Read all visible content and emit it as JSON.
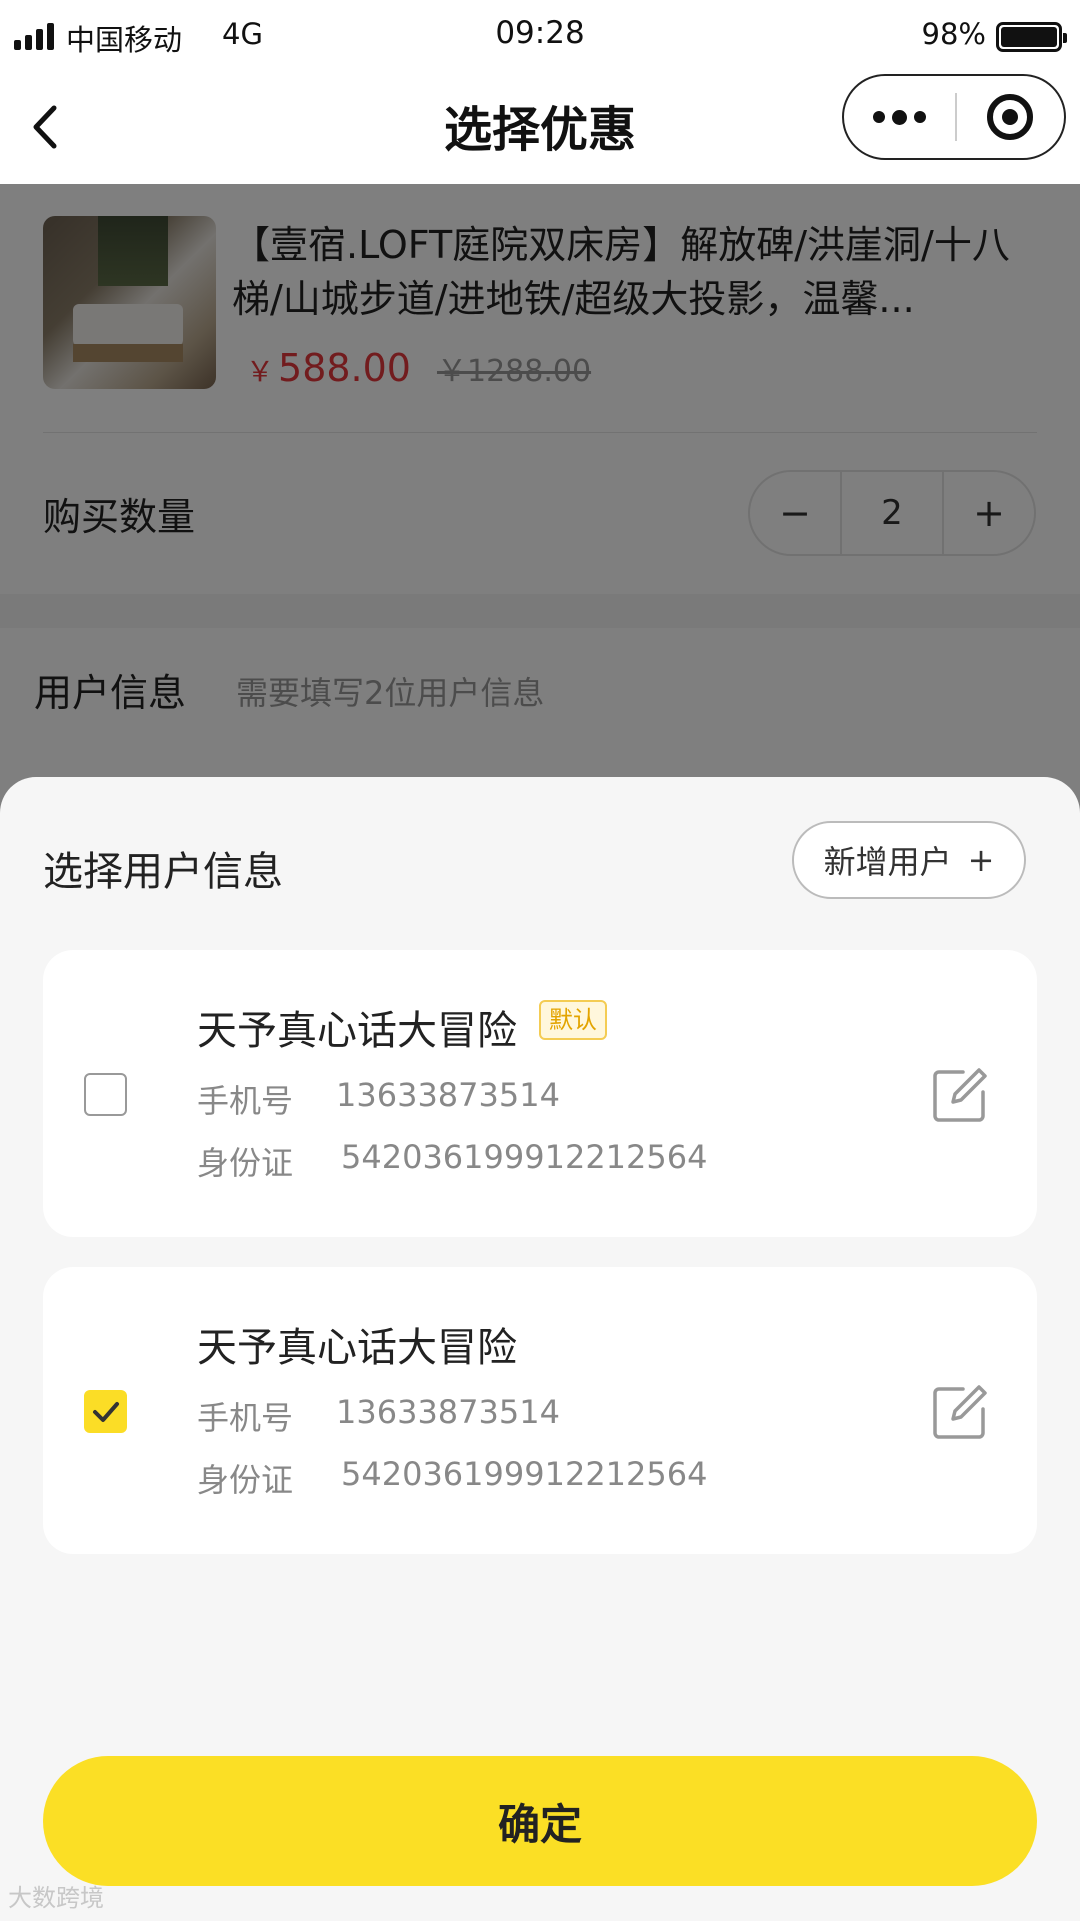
{
  "status_bar": {
    "carrier": "中国移动",
    "network": "4G",
    "time": "09:28",
    "battery_percent": "98%"
  },
  "nav": {
    "title": "选择优惠"
  },
  "product": {
    "name": "【壹宿.LOFT庭院双床房】解放碑/洪崖洞/十八梯/山城步道/进地铁/超级大投影，温馨...",
    "currency": "￥",
    "price": "588.00",
    "original_price": "￥1288.00"
  },
  "quantity": {
    "label": "购买数量",
    "minus": "−",
    "value": "2",
    "plus": "+"
  },
  "user_info": {
    "label": "用户信息",
    "hint": "需要填写2位用户信息"
  },
  "sheet": {
    "title": "选择用户信息",
    "add_user_label": "新增用户",
    "add_user_icon": "+",
    "users": [
      {
        "name": "天予真心话大冒险",
        "badge": "默认",
        "phone_label": "手机号",
        "phone": "13633873514",
        "id_label": "身份证",
        "id_number": "542036199912212564",
        "checked": false
      },
      {
        "name": "天予真心话大冒险",
        "phone_label": "手机号",
        "phone": "13633873514",
        "id_label": "身份证",
        "id_number": "542036199912212564",
        "checked": true
      }
    ],
    "confirm_label": "确定"
  },
  "watermark": "大数跨境",
  "colors": {
    "accent_yellow": "#fbdf25",
    "price_red": "#e4393c",
    "badge_orange": "#e3a400"
  }
}
